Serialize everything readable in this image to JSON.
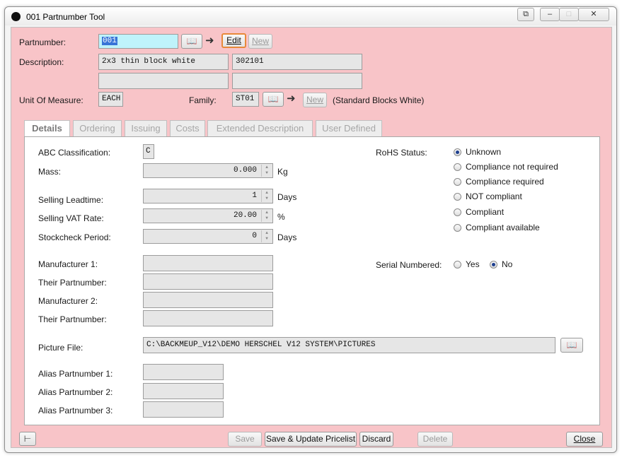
{
  "window": {
    "title": "001 Partnumber Tool",
    "controls": {
      "docs": "⧉",
      "minimize": "–",
      "maximize": "□",
      "close": "✕"
    }
  },
  "header": {
    "partnumber_label": "Partnumber:",
    "partnumber_value": "001",
    "edit_label": "Edit",
    "new_label": "New",
    "description_label": "Description:",
    "description_1": "2x3 thin block white",
    "description_2": "302101",
    "description_3": "",
    "description_4": "",
    "uom_label": "Unit Of Measure:",
    "uom_value": "EACH",
    "family_label": "Family:",
    "family_value": "ST01",
    "family_new_label": "New",
    "family_desc": "(Standard Blocks White)"
  },
  "tabs": [
    "Details",
    "Ordering",
    "Issuing",
    "Costs",
    "Extended Description",
    "User Defined"
  ],
  "details": {
    "abc_label": "ABC Classification:",
    "abc_value": "C",
    "mass_label": "Mass:",
    "mass_value": "0.000",
    "mass_unit": "Kg",
    "leadtime_label": "Selling Leadtime:",
    "leadtime_value": "1",
    "leadtime_unit": "Days",
    "vat_label": "Selling VAT Rate:",
    "vat_value": "20.00",
    "vat_unit": "%",
    "stockcheck_label": "Stockcheck Period:",
    "stockcheck_value": "0",
    "stockcheck_unit": "Days",
    "mfr1_label": "Manufacturer 1:",
    "their1_label": "Their Partnumber:",
    "mfr2_label": "Manufacturer 2:",
    "their2_label": "Their Partnumber:",
    "picture_label": "Picture File:",
    "picture_value": "C:\\BACKMEUP_V12\\DEMO HERSCHEL  V12 SYSTEM\\PICTURES",
    "alias1_label": "Alias Partnumber 1:",
    "alias2_label": "Alias Partnumber 2:",
    "alias3_label": "Alias Partnumber 3:",
    "rohs_label": "RoHS Status:",
    "rohs_options": [
      "Unknown",
      "Compliance not required",
      "Compliance required",
      "NOT compliant",
      "Compliant",
      "Compliant available"
    ],
    "rohs_selected": "Unknown",
    "serial_label": "Serial Numbered:",
    "serial_yes": "Yes",
    "serial_no": "No",
    "serial_selected": "No"
  },
  "footer": {
    "save": "Save",
    "save_update": "Save & Update Pricelist",
    "discard": "Discard",
    "delete": "Delete",
    "close": "Close"
  }
}
